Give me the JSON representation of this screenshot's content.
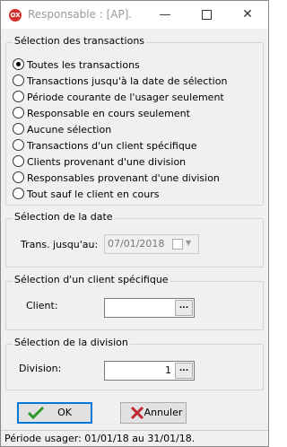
{
  "window": {
    "title": "Responsable : [AP].",
    "icon_text": "OX"
  },
  "titlebar": {
    "minimize": "—",
    "close": "✕"
  },
  "transactions": {
    "title": "Sélection des transactions",
    "options": [
      "Toutes les transactions",
      "Transactions jusqu'à la date de sélection",
      "Période courante de l'usager seulement",
      "Responsable en cours seulement",
      "Aucune sélection",
      "Transactions d'un client spécifique",
      "Clients provenant d'une division",
      "Responsables provenant d'une division",
      "Tout sauf le client en cours"
    ],
    "selected_index": 0
  },
  "date": {
    "title": "Sélection de la date",
    "label": "Trans. jusqu'au:",
    "value": "07/01/2018"
  },
  "client": {
    "title": "Sélection d'un client spécifique",
    "label": "Client:",
    "value": ""
  },
  "division": {
    "title": "Sélection de la division",
    "label": "Division:",
    "value": "1"
  },
  "buttons": {
    "ok": "OK",
    "cancel": "Annuler",
    "ellipsis": "..."
  },
  "status": "Période usager: 01/01/18 au 31/01/18."
}
